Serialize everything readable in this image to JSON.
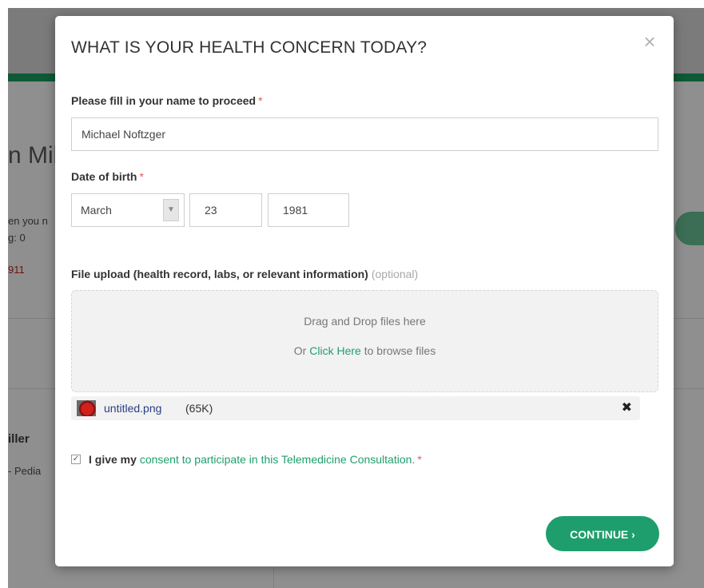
{
  "background": {
    "partial_name": "n Mil",
    "line1": "en you n",
    "line2": "g: 0",
    "phone_fragment": "911",
    "doctor_fragment": "iller",
    "specialty_fragment": "- Pedia"
  },
  "modal": {
    "title": "WHAT IS YOUR HEALTH CONCERN TODAY?",
    "close_glyph": "×",
    "name_label": "Please fill in your name to proceed",
    "required_mark": "*",
    "name_value": "Michael Noftzger",
    "dob_label": "Date of birth",
    "dob_month": "March",
    "dob_day": "23",
    "dob_year": "1981",
    "upload_label": "File upload (health record, labs, or relevant information)",
    "upload_optional": "(optional)",
    "dropzone_line1": "Drag and Drop files here",
    "dropzone_or": "Or",
    "dropzone_link": "Click Here",
    "dropzone_suffix": "to browse files",
    "file_name": "untitled.png",
    "file_size": "(65K)",
    "file_remove_glyph": "✖",
    "consent_prefix": "I give my",
    "consent_link": "consent to participate in this Telemedicine Consultation.",
    "continue_label": "CONTINUE ›"
  },
  "colors": {
    "accent": "#1e9e6d",
    "required": "#e05a5a",
    "file_link": "#2a3e84"
  }
}
